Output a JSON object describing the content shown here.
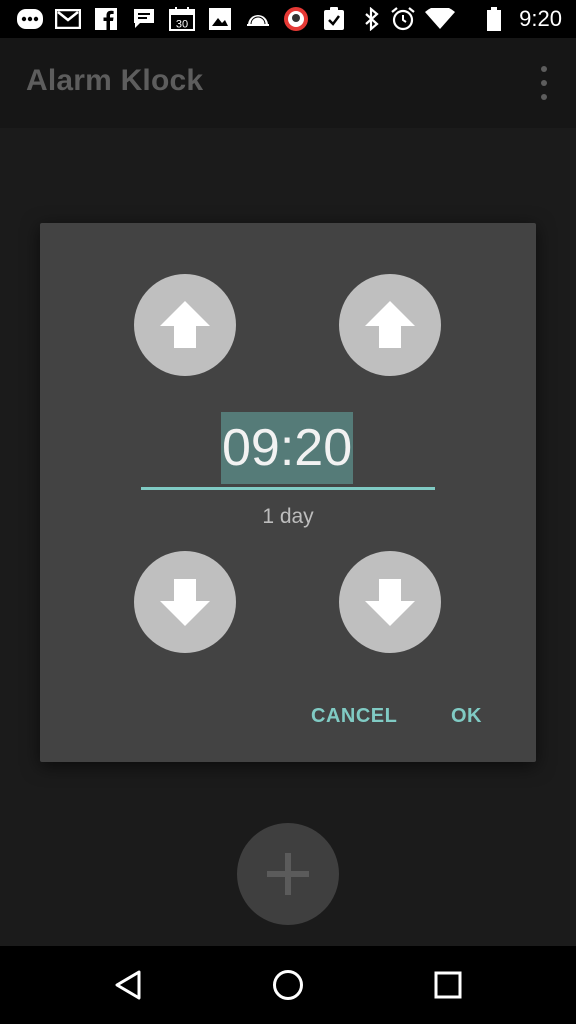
{
  "status_bar": {
    "time": "9:20",
    "icons": [
      "messages-icon",
      "gmail-icon",
      "facebook-icon",
      "chat-icon",
      "calendar-icon",
      "photos-icon",
      "cloud-icon",
      "app-icon",
      "clipboard-icon",
      "bluetooth-icon",
      "alarm-icon",
      "wifi-icon",
      "battery-icon"
    ],
    "calendar_day": "30"
  },
  "app_bar": {
    "title": "Alarm Klock",
    "menu_icon": "overflow-menu-icon"
  },
  "dialog": {
    "time_value": "09:20",
    "duration_label": "1 day",
    "cancel_label": "CANCEL",
    "ok_label": "OK",
    "buttons": {
      "hour_up": "arrow-up-icon",
      "minute_up": "arrow-up-icon",
      "hour_down": "arrow-down-icon",
      "minute_down": "arrow-down-icon"
    }
  },
  "fab": {
    "icon": "plus-icon"
  },
  "nav_bar": {
    "back": "back-icon",
    "home": "home-icon",
    "recents": "recents-icon"
  },
  "colors": {
    "accent": "#80cbc4",
    "dialog_bg": "#434343",
    "selection_bg": "#557b78",
    "circle_button": "#bfbfbf"
  }
}
